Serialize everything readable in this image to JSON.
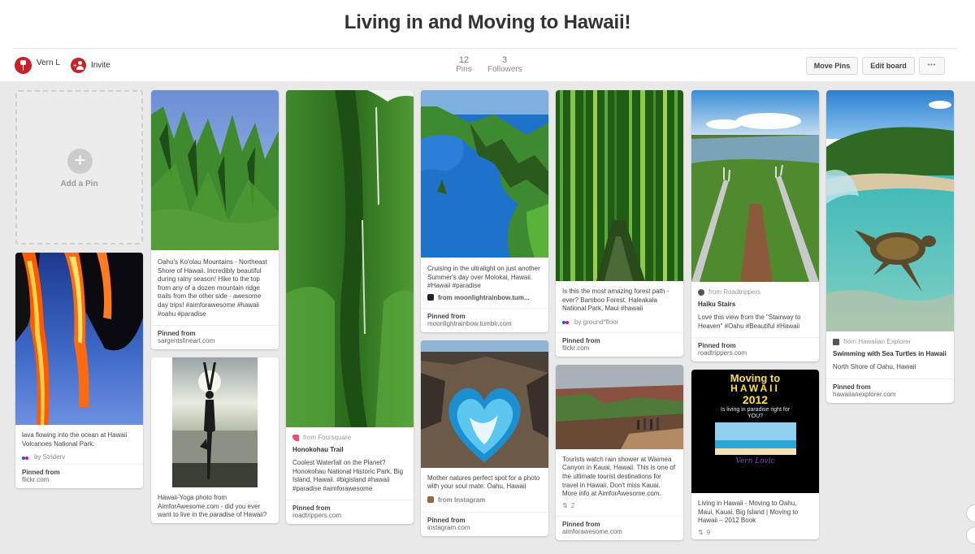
{
  "board": {
    "title": "Living in and Moving to Hawaii!"
  },
  "owner": {
    "name": "Vern L",
    "invite_label": "Invite"
  },
  "stats": {
    "pins_count": "12",
    "pins_label": "Pins",
    "followers_count": "3",
    "followers_label": "Followers"
  },
  "actions": {
    "move_pins": "Move Pins",
    "edit_board": "Edit board",
    "more": "•••"
  },
  "add_pin": {
    "label": "Add a Pin",
    "icon": "plus-icon"
  },
  "pins": {
    "lava": {
      "description": "lava flowing into the ocean at Hawaii Volcanoes National Park.",
      "via": "by Striderv",
      "pinned_from_label": "Pinned from",
      "domain": "flickr.com"
    },
    "koolau": {
      "description": "Oahu's Ko'olau Mountains - Northeast Shore of Hawaii. Incredibly beautiful during rainy season! Hike to the top from any of a dozen mountain ridge trails from the other side - awesome day trips! #aimforawesome #hawaii #oahu #paradise",
      "pinned_from_label": "Pinned from",
      "domain": "sargentsfineart.com"
    },
    "yoga": {
      "description": "Hawaii-Yoga photo from AimforAwesome.com - did you ever want to live in the paradise of Hawaii?"
    },
    "honokohau": {
      "source": "from Foursquare",
      "title": "Honokohau Trail",
      "description": "Coolest Waterfall on the Planet? Honokohau National Historic Park, Big Island, Hawaii. #bigisland #hawaii #paradise #aimforawesome",
      "pinned_from_label": "Pinned from",
      "domain": "roadtrippers.com"
    },
    "molokai": {
      "description": "Cruising in the ultralight on just another Summer's day over Molokai, Hawaii. #Hawaii #paradise",
      "via": "from moonlightrainbow.tum...",
      "pinned_from_label": "Pinned from",
      "domain": "moonlightrainbow.tumblr.com"
    },
    "heart": {
      "description": "Mother natures perfect spot for a photo with your soul mate: Oahu, Hawaii",
      "via": "from Instagram",
      "pinned_from_label": "Pinned from",
      "domain": "instagram.com"
    },
    "bamboo": {
      "description": "Is this the most amazing forest path - ever? Bamboo Forest, Haleakala National Park, Maui #hawaii",
      "via": "by ground*floor",
      "pinned_from_label": "Pinned from",
      "domain": "flickr.com"
    },
    "waimea": {
      "description": "Tourists watch rain shower at Waimea Canyon in Kauai, Hawaii. This is one of the ultimate tourist destinations for travel in Hawaii. Don't miss Kauai. More info at AimforAwesome.com.",
      "repins": "2",
      "pinned_from_label": "Pinned from",
      "domain": "aimforawesome.com"
    },
    "haiku": {
      "source": "from Roadtrippers",
      "title": "Haiku Stairs",
      "description": "Love this view from the \"Stairway to Heaven\" #Oahu #Beautiful #Hawaii",
      "pinned_from_label": "Pinned from",
      "domain": "roadtrippers.com"
    },
    "moving2012": {
      "poster_title": "Moving to",
      "poster_title2": "HAWAII",
      "poster_year": "2012",
      "poster_sub": "Is living in paradise right for YOU?",
      "poster_author": "Vern Lovic",
      "description": "Living in Hawaii - Moving to Oahu, Maui, Kauai, Big Island | Moving to Hawaii – 2012 Book",
      "repins": "9"
    },
    "turtle": {
      "source": "from Hawaiian Explorer",
      "title": "Swimming with Sea Turtles in Hawaii",
      "description": "North Shore of Oahu, Hawaii",
      "pinned_from_label": "Pinned from",
      "domain": "hawaiianexplorer.com"
    }
  },
  "colors": {
    "brand": "#cb2027",
    "flickr_pink": "#ff0084",
    "flickr_blue": "#0063dc",
    "foursquare": "#f94877"
  }
}
